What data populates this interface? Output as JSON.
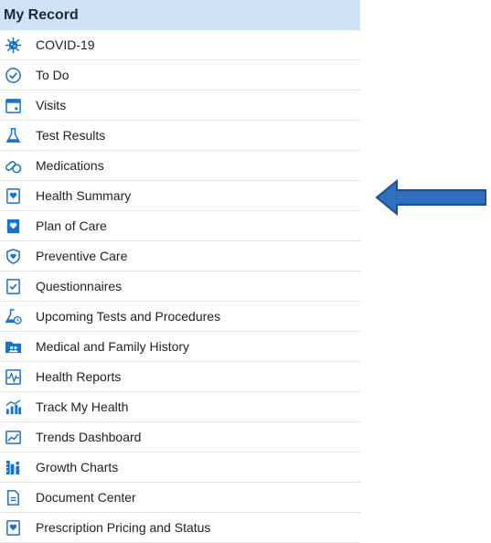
{
  "menu": {
    "header": "My Record",
    "items": [
      {
        "label": "COVID-19",
        "icon": "virus-icon"
      },
      {
        "label": "To Do",
        "icon": "clock-check-icon"
      },
      {
        "label": "Visits",
        "icon": "calendar-icon"
      },
      {
        "label": "Test Results",
        "icon": "flask-icon"
      },
      {
        "label": "Medications",
        "icon": "pills-icon"
      },
      {
        "label": "Health Summary",
        "icon": "clipboard-heart-icon"
      },
      {
        "label": "Plan of Care",
        "icon": "care-plan-icon"
      },
      {
        "label": "Preventive Care",
        "icon": "shield-heart-icon"
      },
      {
        "label": "Questionnaires",
        "icon": "clipboard-check-icon"
      },
      {
        "label": "Upcoming Tests and Procedures",
        "icon": "flask-clock-icon"
      },
      {
        "label": "Medical and Family History",
        "icon": "folder-family-icon"
      },
      {
        "label": "Health Reports",
        "icon": "report-pulse-icon"
      },
      {
        "label": "Track My Health",
        "icon": "bar-graph-icon"
      },
      {
        "label": "Trends Dashboard",
        "icon": "trend-line-icon"
      },
      {
        "label": "Growth Charts",
        "icon": "growth-chart-icon"
      },
      {
        "label": "Document Center",
        "icon": "document-icon"
      },
      {
        "label": "Prescription Pricing and Status",
        "icon": "rx-clipboard-icon"
      }
    ]
  },
  "colors": {
    "header_bg": "#cfe3f7",
    "icon_blue": "#1a73c9",
    "arrow_blue": "#2f6fc0",
    "arrow_outline": "#1e4f8f"
  }
}
